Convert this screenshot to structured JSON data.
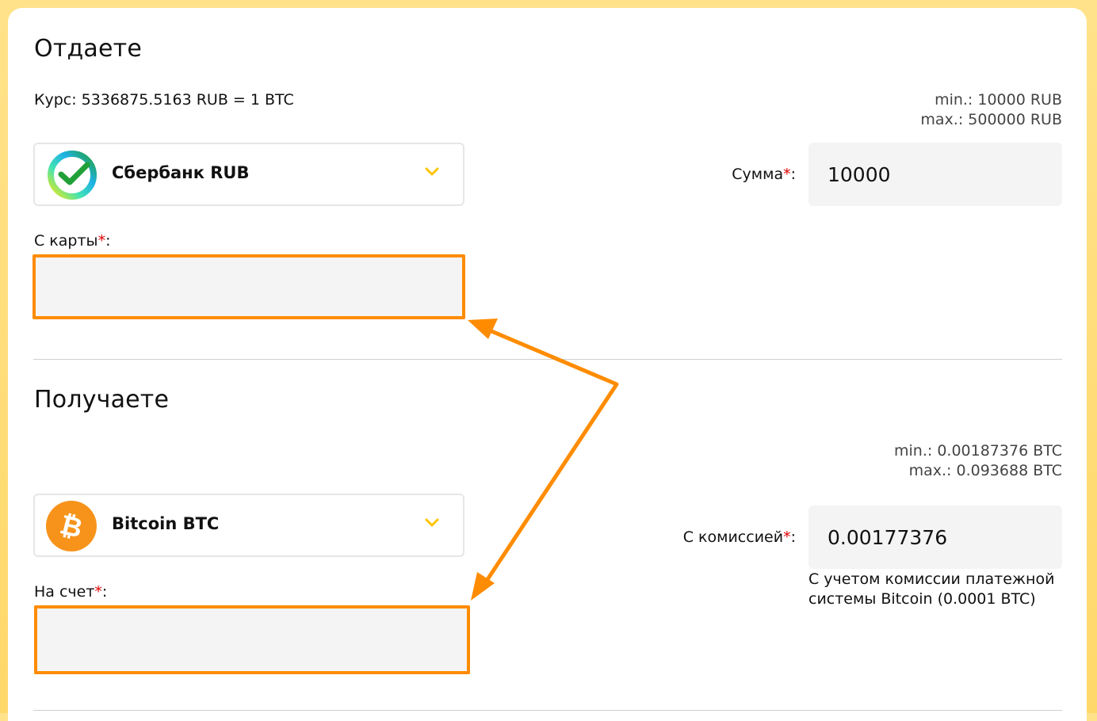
{
  "give": {
    "title": "Отдаете",
    "rate": "Курс: 5336875.5163 RUB = 1 BTC",
    "min": "min.: 10000 RUB",
    "max": "max.: 500000 RUB",
    "currency": "Сбербанк RUB",
    "amount_label": "Сумма",
    "amount_value": "10000",
    "card_label": "С карты",
    "card_value": ""
  },
  "receive": {
    "title": "Получаете",
    "min": "min.: 0.00187376 BTC",
    "max": "max.: 0.093688 BTC",
    "currency": "Bitcoin BTC",
    "fee_label": "С комиссией",
    "fee_value": "0.00177376",
    "fee_note": "С учетом комиссии платежной системы Bitcoin (0.0001 BTC)",
    "account_label": "На счет",
    "account_value": ""
  },
  "common": {
    "required_mark": "*",
    "colon": ":"
  },
  "icons": {
    "give_currency": "sberbank-logo-icon",
    "receive_currency": "bitcoin-logo-icon",
    "dropdown": "chevron-down-icon",
    "annotation": "orange-arrow-annotation"
  },
  "colors": {
    "accent": "#ffc400",
    "highlight": "#ff8c00",
    "required": "#e00000",
    "bitcoin": "#f7931a",
    "sber": "#21a038"
  }
}
